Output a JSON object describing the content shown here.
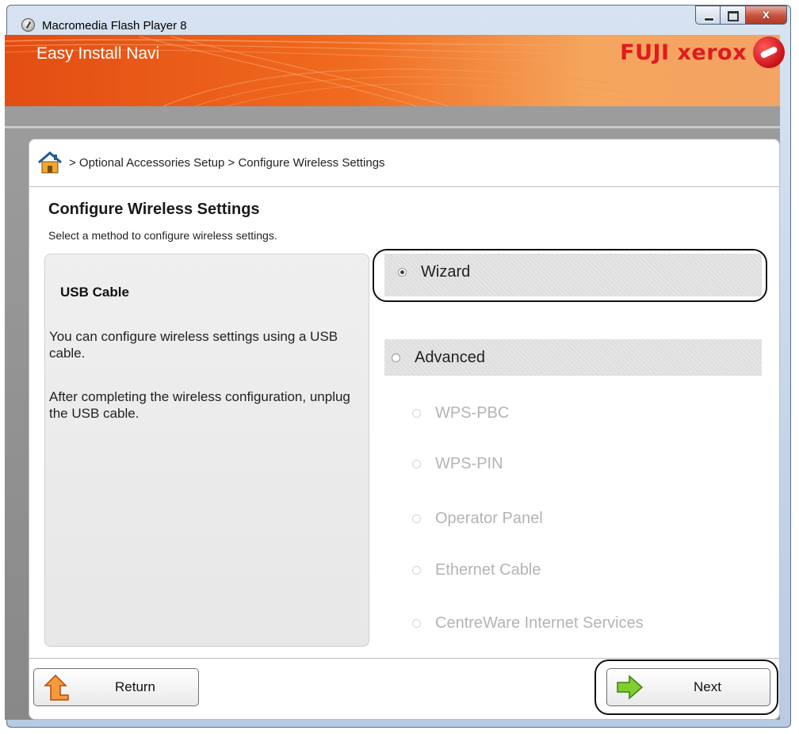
{
  "window": {
    "title": "Macromedia Flash Player 8",
    "close_glyph": "x"
  },
  "header": {
    "app_name": "Easy Install Navi",
    "brand": "FUJI xerox"
  },
  "breadcrumb": {
    "text": "> Optional Accessories Setup > Configure Wireless Settings"
  },
  "page": {
    "title": "Configure Wireless Settings",
    "subtitle": "Select a method to configure wireless settings."
  },
  "info": {
    "title": "USB Cable",
    "para1": "You can configure wireless settings using a USB cable.",
    "para2": "After completing the wireless configuration,  unplug the USB cable."
  },
  "options": {
    "wizard": "Wizard",
    "advanced": "Advanced",
    "sub": [
      "WPS-PBC",
      "WPS-PIN",
      "Operator Panel",
      "Ethernet Cable",
      "CentreWare Internet Services"
    ]
  },
  "buttons": {
    "return": "Return",
    "next": "Next"
  }
}
